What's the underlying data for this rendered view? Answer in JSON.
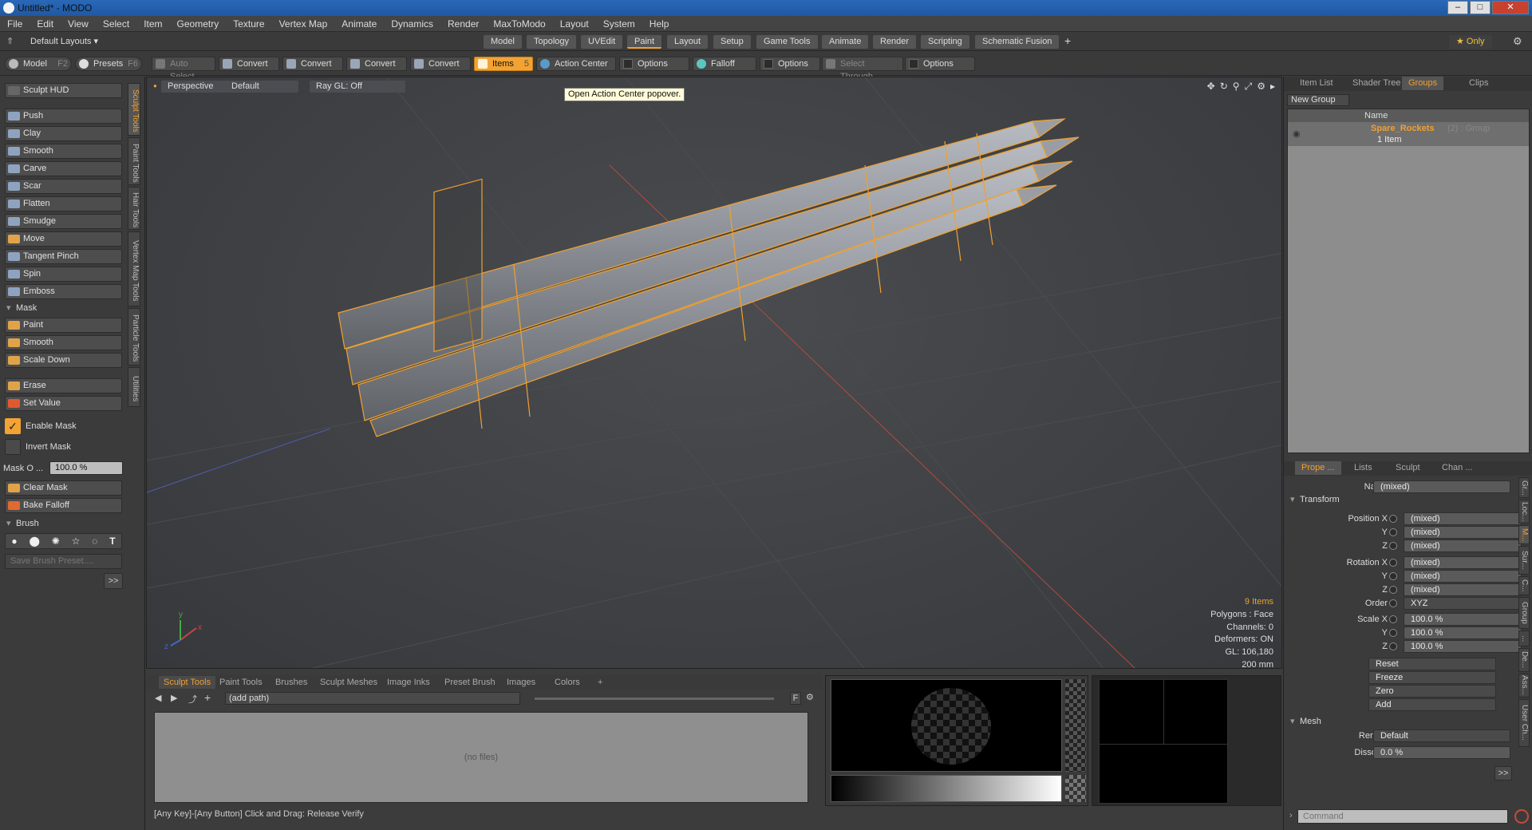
{
  "window": {
    "title": "Untitled* - MODO",
    "minimize": "–",
    "maximize": "□",
    "close": "✕"
  },
  "menu": [
    "File",
    "Edit",
    "View",
    "Select",
    "Item",
    "Geometry",
    "Texture",
    "Vertex Map",
    "Animate",
    "Dynamics",
    "Render",
    "MaxToModo",
    "Layout",
    "System",
    "Help"
  ],
  "layoutbar": {
    "default_layouts": "Default Layouts ▾",
    "tabs": [
      "Model",
      "Topology",
      "UVEdit",
      "Paint",
      "Layout",
      "Setup",
      "Game Tools",
      "Animate",
      "Render",
      "Scripting",
      "Schematic Fusion"
    ],
    "active_tab": "Paint",
    "add": "+",
    "only": "★ Only"
  },
  "toolbar": {
    "model": "Model",
    "model_key": "F2",
    "presets": "Presets",
    "presets_key": "F6",
    "auto_select": "Auto Select",
    "convert1": "Convert",
    "convert2": "Convert",
    "convert3": "Convert",
    "convert4": "Convert",
    "items": "Items",
    "items_key": "5",
    "action_center": "Action Center",
    "options1": "Options",
    "falloff": "Falloff",
    "options2": "Options",
    "select_through": "Select Through",
    "options3": "Options"
  },
  "left": {
    "sculpt_hud": "Sculpt HUD",
    "tools": [
      "Push",
      "Clay",
      "Smooth",
      "Carve",
      "Scar",
      "Flatten",
      "Smudge",
      "Move",
      "Tangent Pinch",
      "Spin",
      "Emboss"
    ],
    "mask_header": "Mask",
    "mask_tools": [
      "Paint",
      "Smooth",
      "Scale Down"
    ],
    "erase": "Erase",
    "set_value": "Set Value",
    "enable_mask": "Enable Mask",
    "invert_mask": "Invert Mask",
    "mask_opacity_label": "Mask O ...",
    "mask_opacity_value": "100.0 %",
    "clear_mask": "Clear Mask",
    "bake_falloff": "Bake Falloff",
    "brush_header": "Brush",
    "save_brush": "Save Brush Preset....",
    "more": ">>",
    "vtabs": [
      "Sculpt Tools",
      "Paint Tools",
      "Hair Tools",
      "Vertex Map Tools",
      "Particle Tools",
      "Utilities"
    ]
  },
  "viewport": {
    "view": "Perspective",
    "shading": "Default",
    "raygl": "Ray GL: Off",
    "tooltip": "Open Action Center popover.",
    "info": {
      "items": "9 Items",
      "polygons": "Polygons : Face",
      "channels": "Channels: 0",
      "deformers": "Deformers: ON",
      "gl": "GL: 106,180",
      "scale": "200 mm"
    },
    "axis_x": "x",
    "axis_y": "y",
    "axis_z": "z"
  },
  "right": {
    "top_tabs": [
      "Item List",
      "Shader Tree",
      "Groups",
      "Clips"
    ],
    "active_top": "Groups",
    "new_group": "New Group",
    "col_name": "Name",
    "group_name": "Spare_Rockets",
    "group_meta": "(2) : Group",
    "group_items": "1 Item",
    "prop_tabs": [
      "Prope ...",
      "Lists",
      "Sculpt",
      "Chan ..."
    ],
    "name_label": "Name",
    "name_value": "(mixed)",
    "transform_header": "Transform",
    "pos_x": "Position X",
    "y": "Y",
    "z": "Z",
    "mixed": "(mixed)",
    "rot_x": "Rotation X",
    "order": "Order",
    "order_value": "XYZ",
    "scale_x": "Scale X",
    "scale_value": "100.0 %",
    "reset": "Reset",
    "freeze": "Freeze",
    "zero": "Zero",
    "add": "Add",
    "mesh_header": "Mesh",
    "render_label": "Render",
    "render_value": "Default",
    "dissolve_label": "Dissolve",
    "dissolve_value": "0.0 %",
    "more": ">>",
    "side_tabs": [
      "Gr...",
      "Loc...",
      "M...",
      "Sur...",
      "C...",
      "Group",
      "...",
      "De...",
      "Ass...",
      "User Ch..."
    ],
    "command_placeholder": "Command"
  },
  "bottom": {
    "tabs": [
      "Sculpt Tools",
      "Paint Tools",
      "Brushes",
      "Sculpt Meshes",
      "Image Inks",
      "Preset Brush",
      "Images",
      "Colors"
    ],
    "active": "Sculpt Tools",
    "add": "+",
    "path": "(add path)",
    "no_files": "(no files)",
    "f_btn": "F"
  },
  "status": "[Any Key]-[Any Button] Click and Drag:  Release Verify"
}
